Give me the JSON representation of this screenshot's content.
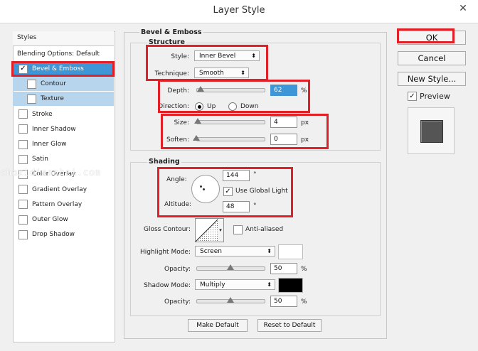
{
  "window": {
    "title": "Layer Style",
    "close_glyph": "✕"
  },
  "styles_panel": {
    "header": "Styles",
    "items": [
      {
        "label": "Blending Options: Default",
        "checkbox": false,
        "checked": false,
        "state": "normal"
      },
      {
        "label": "Bevel & Emboss",
        "checkbox": true,
        "checked": true,
        "state": "selected"
      },
      {
        "label": "Contour",
        "checkbox": true,
        "checked": false,
        "state": "sub"
      },
      {
        "label": "Texture",
        "checkbox": true,
        "checked": false,
        "state": "sub"
      },
      {
        "label": "Stroke",
        "checkbox": true,
        "checked": false,
        "state": "normal"
      },
      {
        "label": "Inner Shadow",
        "checkbox": true,
        "checked": false,
        "state": "normal"
      },
      {
        "label": "Inner Glow",
        "checkbox": true,
        "checked": false,
        "state": "normal"
      },
      {
        "label": "Satin",
        "checkbox": true,
        "checked": false,
        "state": "normal"
      },
      {
        "label": "Color Overlay",
        "checkbox": true,
        "checked": false,
        "state": "normal"
      },
      {
        "label": "Gradient Overlay",
        "checkbox": true,
        "checked": false,
        "state": "normal"
      },
      {
        "label": "Pattern Overlay",
        "checkbox": true,
        "checked": false,
        "state": "normal"
      },
      {
        "label": "Outer Glow",
        "checkbox": true,
        "checked": false,
        "state": "normal"
      },
      {
        "label": "Drop Shadow",
        "checkbox": true,
        "checked": false,
        "state": "normal"
      }
    ]
  },
  "bevel": {
    "section_title": "Bevel & Emboss",
    "structure_title": "Structure",
    "style_label": "Style:",
    "style_value": "Inner Bevel",
    "technique_label": "Technique:",
    "technique_value": "Smooth",
    "depth_label": "Depth:",
    "depth_value": "62",
    "depth_fraction": 0.06,
    "depth_unit": "%",
    "direction_label": "Direction:",
    "direction_up": "Up",
    "direction_down": "Down",
    "size_label": "Size:",
    "size_value": "4",
    "size_fraction": 0.02,
    "size_unit": "px",
    "soften_label": "Soften:",
    "soften_value": "0",
    "soften_fraction": 0.0,
    "soften_unit": "px"
  },
  "shading": {
    "title": "Shading",
    "angle_label": "Angle:",
    "angle_value": "144",
    "angle_unit": "°",
    "global_light_label": "Use Global Light",
    "altitude_label": "Altitude:",
    "altitude_value": "48",
    "altitude_unit": "°",
    "gloss_contour_label": "Gloss Contour:",
    "anti_aliased_label": "Anti-aliased",
    "highlight_mode_label": "Highlight Mode:",
    "highlight_mode_value": "Screen",
    "highlight_color": "#ffffff",
    "highlight_opacity_label": "Opacity:",
    "highlight_opacity_value": "50",
    "highlight_opacity_fraction": 0.5,
    "highlight_opacity_unit": "%",
    "shadow_mode_label": "Shadow Mode:",
    "shadow_mode_value": "Multiply",
    "shadow_color": "#000000",
    "shadow_opacity_label": "Opacity:",
    "shadow_opacity_value": "50",
    "shadow_opacity_fraction": 0.5,
    "shadow_opacity_unit": "%"
  },
  "footer": {
    "make_default": "Make Default",
    "reset_default": "Reset to Default"
  },
  "actions": {
    "ok": "OK",
    "cancel": "Cancel",
    "new_style": "New Style...",
    "preview": "Preview"
  },
  "watermark": "chazidianshei.com",
  "colors": {
    "selection": "#3e96d7",
    "sub_selection": "#b8d5ee",
    "annotation": "#e01f26",
    "preview_swatch": "#555555"
  }
}
